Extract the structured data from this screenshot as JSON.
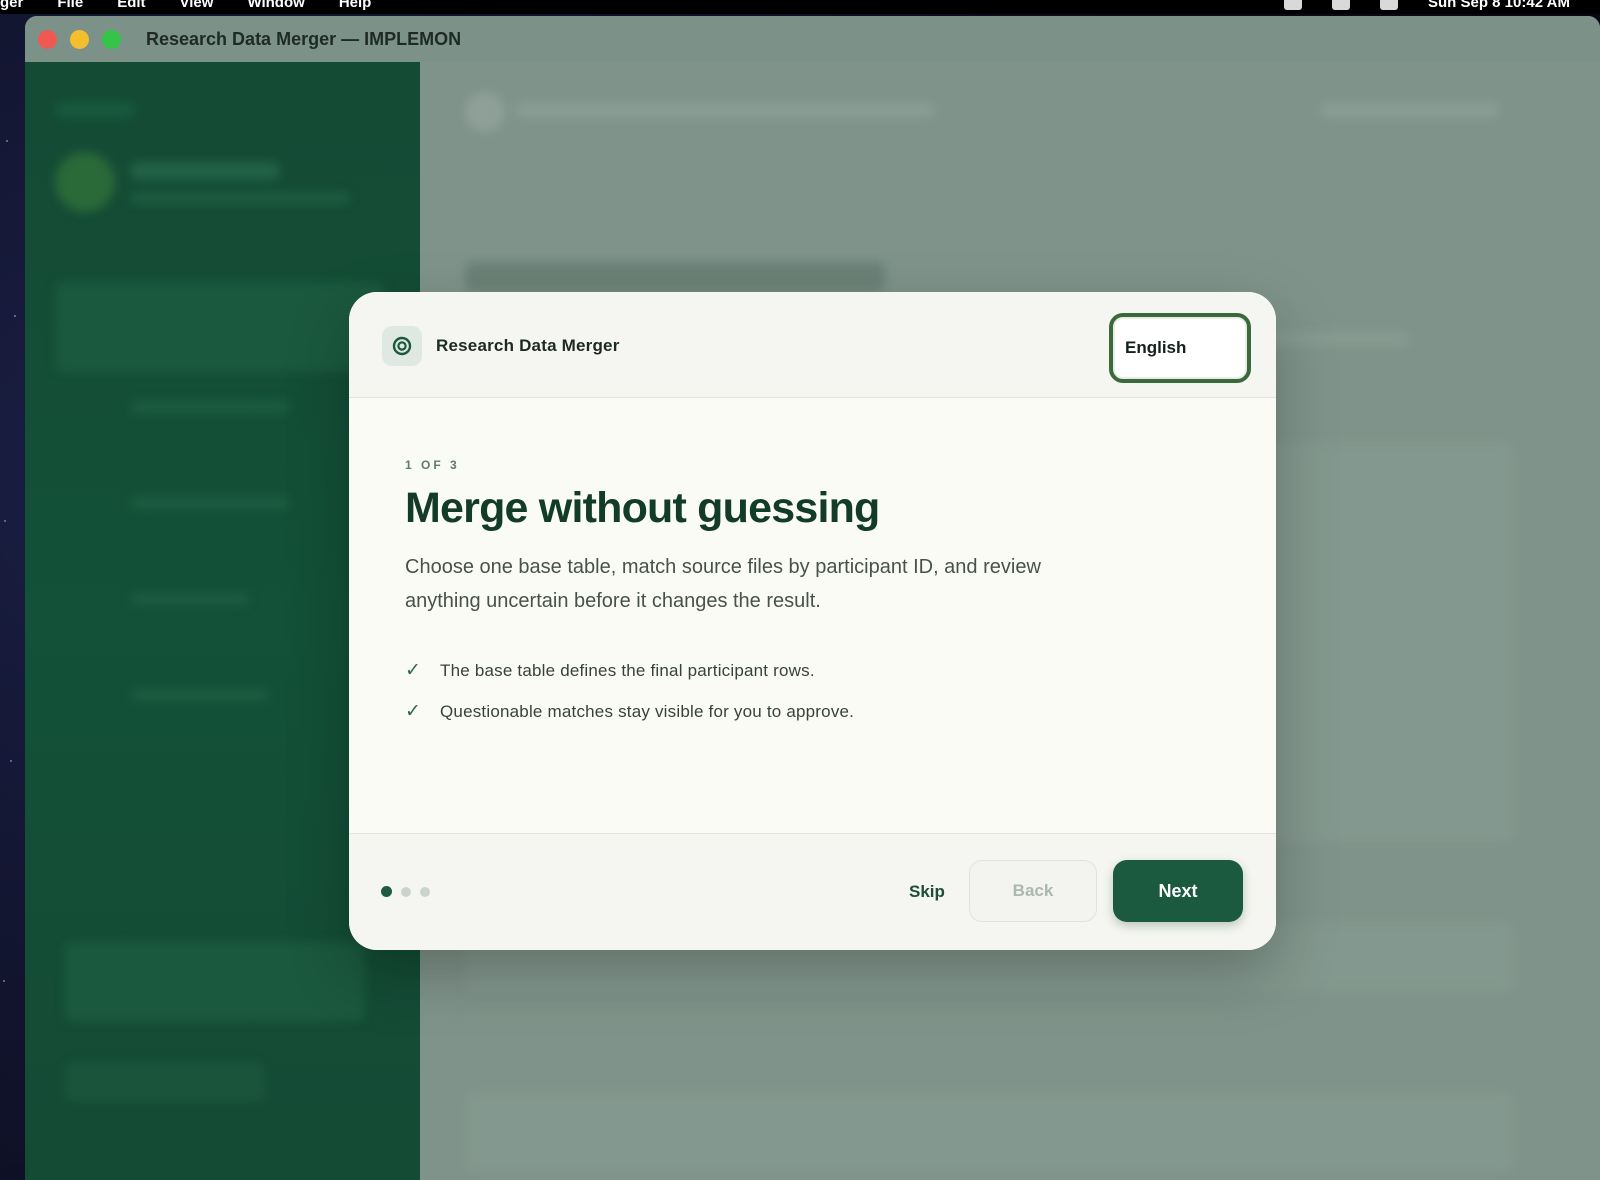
{
  "menubar": {
    "items": [
      "ger",
      "File",
      "Edit",
      "View",
      "Window",
      "Help"
    ],
    "clock": "Sun Sep 8  10:42 AM"
  },
  "window": {
    "title": "Research Data Merger — IMPLEMON"
  },
  "modal": {
    "app_name": "Research Data Merger",
    "language": "English",
    "step_label": "1 OF 3",
    "headline": "Merge without guessing",
    "description": "Choose one base table, match source files by participant ID, and review anything uncertain before it changes the result.",
    "bullets": [
      "The base table defines the final participant rows.",
      "Questionable matches stay visible for you to approve."
    ],
    "progress": {
      "current": 1,
      "total": 3
    },
    "buttons": {
      "skip": "Skip",
      "back": "Back",
      "next": "Next"
    }
  },
  "colors": {
    "accent": "#1c5a3f",
    "sidebar": "#0f4a33",
    "headline": "#133b2a",
    "focus_ring": "#3b6a3a"
  },
  "icons": {
    "app_logo": "target-icon",
    "bullet": "check-icon"
  }
}
